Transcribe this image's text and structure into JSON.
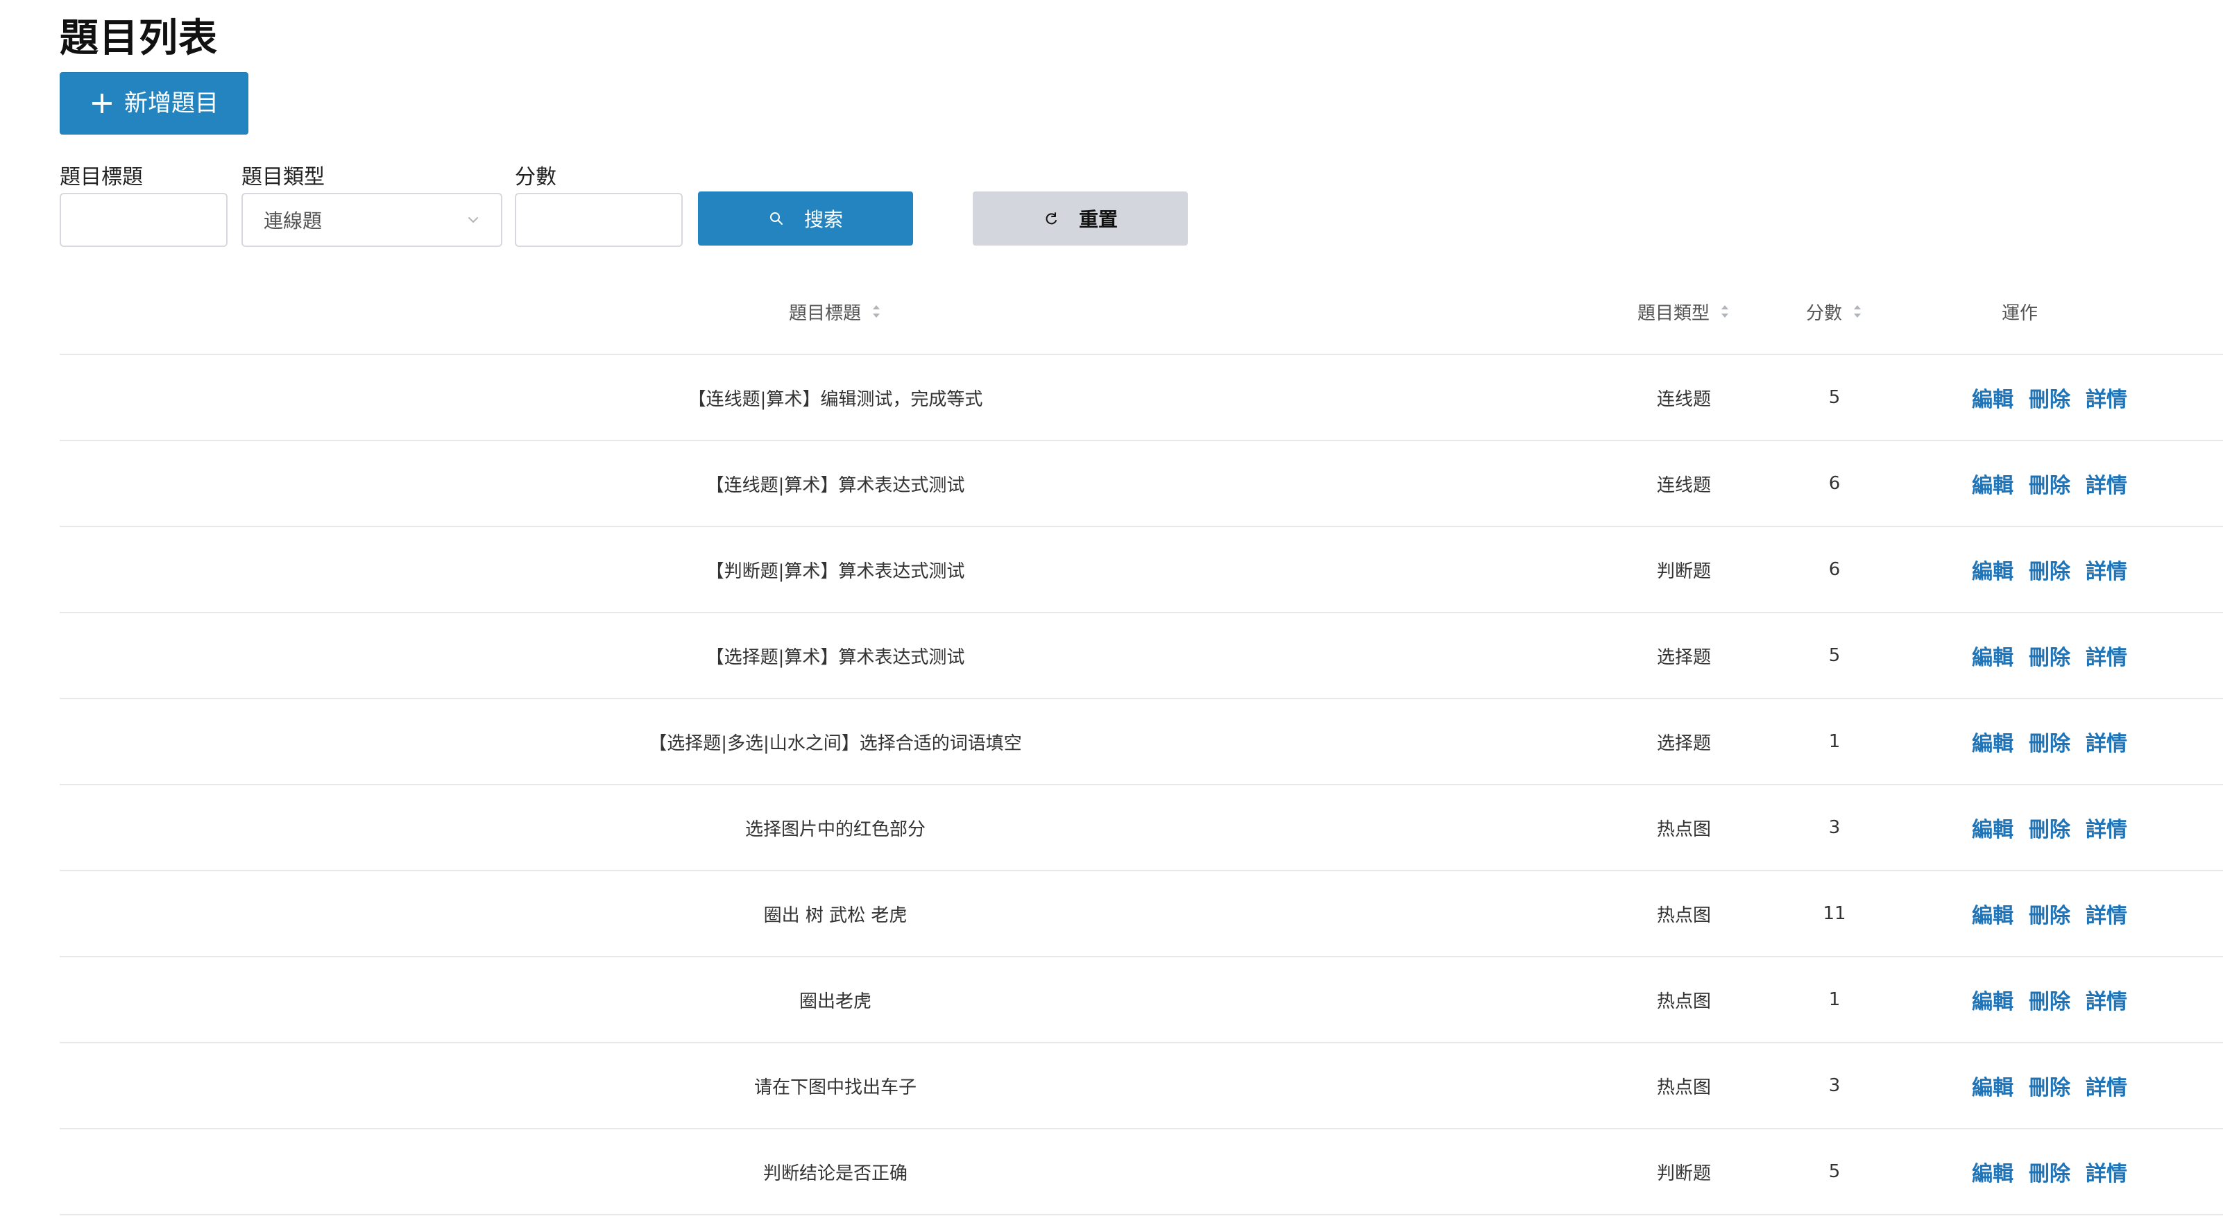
{
  "page": {
    "title": "題目列表"
  },
  "toolbar": {
    "add_label": "新增題目"
  },
  "filters": {
    "title_label": "題目標題",
    "type_label": "題目類型",
    "score_label": "分數",
    "title_value": "",
    "type_value": "連線題",
    "score_value": ""
  },
  "buttons": {
    "search_label": "搜索",
    "reset_label": "重置"
  },
  "table": {
    "headers": [
      "題目標題",
      "題目類型",
      "分數",
      "運作"
    ],
    "rows": [
      {
        "title": "【连线题|算术】编辑测试，完成等式",
        "type": "连线题",
        "score": "5",
        "actions": [
          "編輯",
          "刪除",
          "詳情"
        ]
      },
      {
        "title": "【连线题|算术】算术表达式测试",
        "type": "连线题",
        "score": "6",
        "actions": [
          "編輯",
          "刪除",
          "詳情"
        ]
      },
      {
        "title": "【判断题|算术】算术表达式测试",
        "type": "判断题",
        "score": "6",
        "actions": [
          "編輯",
          "刪除",
          "詳情"
        ]
      },
      {
        "title": "【选择题|算术】算术表达式测试",
        "type": "选择题",
        "score": "5",
        "actions": [
          "編輯",
          "刪除",
          "詳情"
        ]
      },
      {
        "title": "【选择题|多选|山水之间】选择合适的词语填空",
        "type": "选择题",
        "score": "1",
        "actions": [
          "編輯",
          "刪除",
          "詳情"
        ]
      },
      {
        "title": "选择图片中的红色部分",
        "type": "热点图",
        "score": "3",
        "actions": [
          "編輯",
          "刪除",
          "詳情"
        ]
      },
      {
        "title": "圈出 树 武松 老虎",
        "type": "热点图",
        "score": "11",
        "actions": [
          "編輯",
          "刪除",
          "詳情"
        ]
      },
      {
        "title": "圈出老虎",
        "type": "热点图",
        "score": "1",
        "actions": [
          "編輯",
          "刪除",
          "詳情"
        ]
      },
      {
        "title": "请在下图中找出车子",
        "type": "热点图",
        "score": "3",
        "actions": [
          "編輯",
          "刪除",
          "詳情"
        ]
      },
      {
        "title": "判断结论是否正确",
        "type": "判断题",
        "score": "5",
        "actions": [
          "編輯",
          "刪除",
          "詳情"
        ]
      }
    ]
  },
  "icons": {
    "add": "plus-icon",
    "search": "search-icon",
    "reset": "refresh-icon",
    "chevron": "chevron-down-icon",
    "sort": "sort-icon"
  },
  "colors": {
    "primary": "#2384bf",
    "link": "#1f74b8",
    "reset_bg": "#d3d6dc",
    "border": "#d6d9de",
    "divider": "#e7e8eb"
  }
}
